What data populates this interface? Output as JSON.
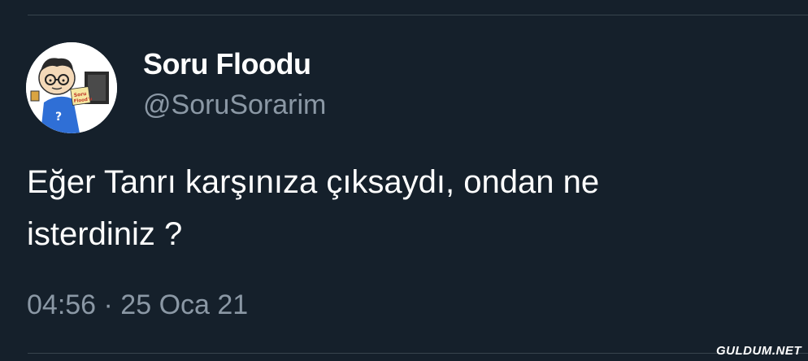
{
  "tweet": {
    "author": {
      "display_name": "Soru Floodu",
      "handle": "@SoruSorarim",
      "avatar_icon": "cartoon-avatar-icon",
      "avatar_text": "Soru Flood'u"
    },
    "text_line1": "Eğer Tanrı karşınıza çıksaydı, ondan ne",
    "text_line2": "isterdiniz ?",
    "timestamp": "04:56 · 25 Oca 21"
  },
  "watermark": "GULDUM.NET",
  "colors": {
    "background": "#15202b",
    "text_primary": "#ffffff",
    "text_secondary": "#8b98a5",
    "divider": "#38444d"
  }
}
